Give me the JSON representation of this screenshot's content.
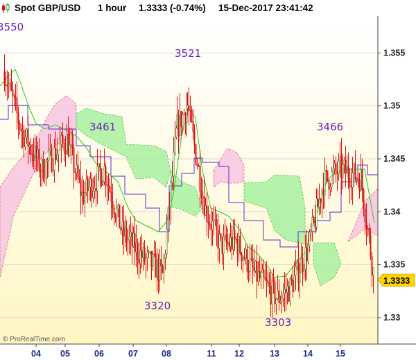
{
  "header": {
    "instrument": "Spot GBP/USD",
    "interval": "1 hour",
    "quote": "1.3333 (-0.74%)",
    "datetime": "15-Dec-2017 23:41:42"
  },
  "watermark": "© ProRealTime.com",
  "colors": {
    "candle_up": "#228b22",
    "candle_down": "#dd1111",
    "kijun": "#5a2ccc",
    "tenkan": "#22cc22",
    "cloud_bull": "#a8f0a0",
    "cloud_bear": "#f8c4e0",
    "last_price_box": "#ffd400"
  },
  "chart_data": {
    "type": "candlestick",
    "title": "Spot GBP/USD 1 hour",
    "ylim": [
      1.3275,
      1.3585
    ],
    "y_ticks": [
      "1.355",
      "1.35",
      "1.345",
      "1.34",
      "1.335",
      "1.33"
    ],
    "x_ticks": [
      "04",
      "05",
      "06",
      "07",
      "08",
      "11",
      "12",
      "13",
      "14",
      "15"
    ],
    "last_price": "1.3333",
    "annotations": [
      {
        "text": "3550",
        "x": "03",
        "y": 1.355
      },
      {
        "text": "3461",
        "x": "05",
        "y": 1.3461
      },
      {
        "text": "3521",
        "x": "08",
        "y": 1.3521
      },
      {
        "text": "3320",
        "x": "07",
        "y": 1.332
      },
      {
        "text": "3303",
        "x": "13",
        "y": 1.3303
      },
      {
        "text": "3466",
        "x": "14",
        "y": 1.3466
      }
    ],
    "close_path": [
      [
        "03",
        1.3532
      ],
      [
        "04",
        1.3478
      ],
      [
        "04",
        1.344
      ],
      [
        "05",
        1.3468
      ],
      [
        "05",
        1.3415
      ],
      [
        "06",
        1.344
      ],
      [
        "06",
        1.338
      ],
      [
        "07",
        1.3355
      ],
      [
        "07",
        1.3348
      ],
      [
        "08",
        1.334
      ],
      [
        "08",
        1.348
      ],
      [
        "08",
        1.35
      ],
      [
        "11",
        1.3402
      ],
      [
        "11",
        1.3368
      ],
      [
        "12",
        1.3372
      ],
      [
        "12",
        1.3342
      ],
      [
        "13",
        1.3318
      ],
      [
        "13",
        1.3328
      ],
      [
        "14",
        1.3365
      ],
      [
        "14",
        1.3428
      ],
      [
        "15",
        1.344
      ],
      [
        "15",
        1.3432
      ],
      [
        "15",
        1.3333
      ]
    ]
  }
}
